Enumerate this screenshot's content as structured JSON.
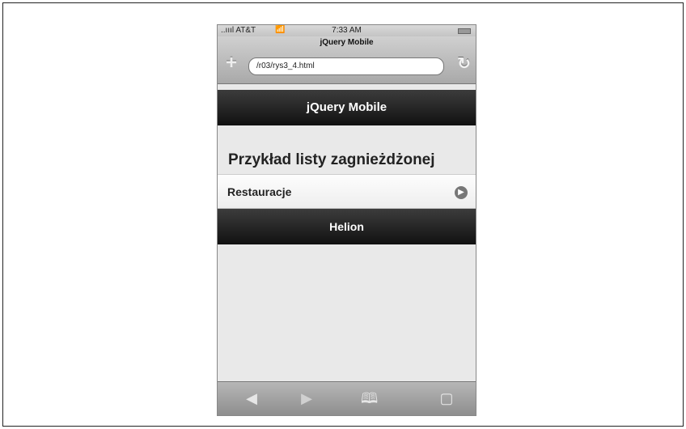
{
  "status_bar": {
    "carrier": "..ıııl AT&T",
    "time": "7:33 AM"
  },
  "browser": {
    "title": "jQuery Mobile",
    "url": "/r03/rys3_4.html"
  },
  "header": {
    "title": "jQuery Mobile"
  },
  "content": {
    "heading": "Przykład listy zagnieżdżonej",
    "list_items": [
      {
        "label": "Restauracje"
      }
    ]
  },
  "footer": {
    "title": "Helion"
  },
  "icons": {
    "wifi": "wifi-icon",
    "battery": "battery-icon",
    "plus": "plus-icon",
    "reload": "reload-icon",
    "arrow": "chevron-right-icon",
    "back": "back-arrow-icon",
    "forward": "forward-arrow-icon",
    "bookmarks": "bookmarks-icon",
    "pages": "pages-icon"
  }
}
